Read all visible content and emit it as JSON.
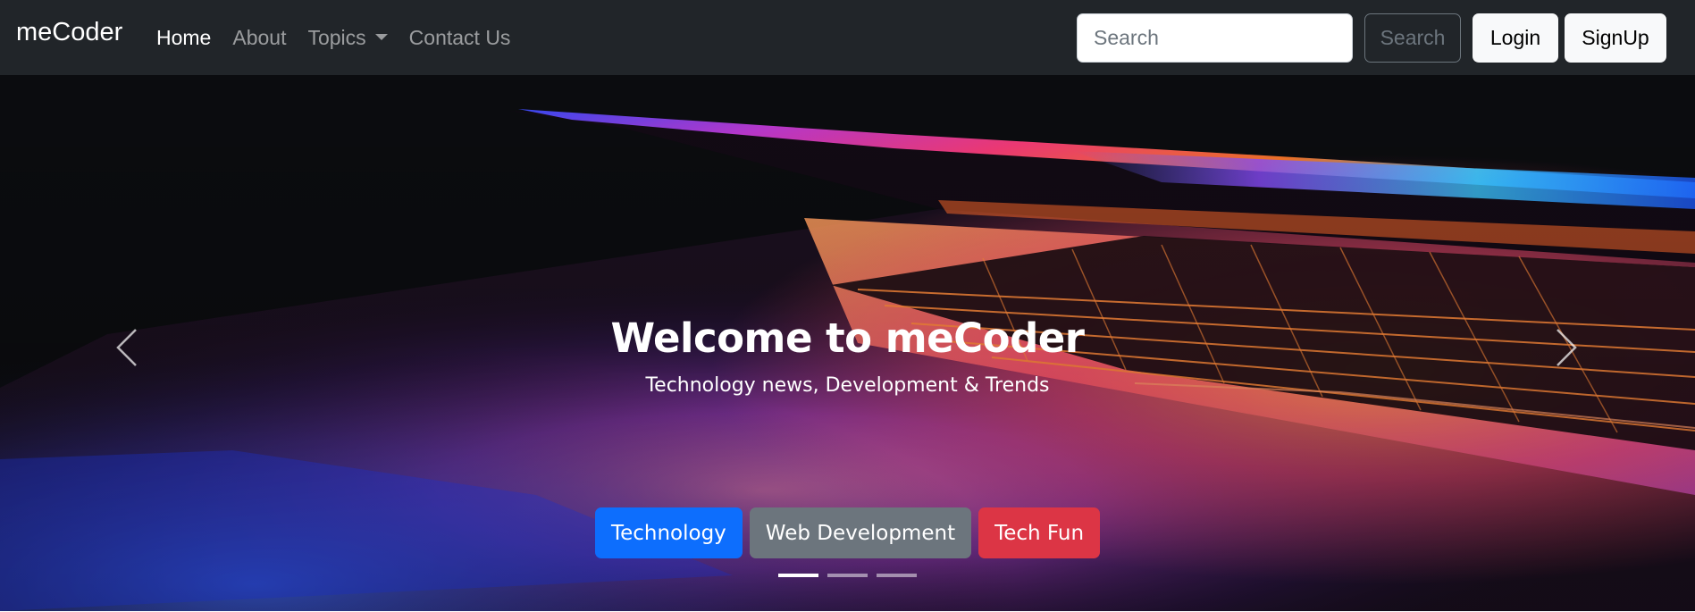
{
  "navbar": {
    "brand": "meCoder",
    "links": [
      {
        "label": "Home",
        "active": true
      },
      {
        "label": "About"
      },
      {
        "label": "Topics",
        "dropdown": true
      },
      {
        "label": "Contact Us"
      }
    ],
    "search": {
      "placeholder": "Search",
      "button_label": "Search"
    },
    "login_label": "Login",
    "signup_label": "SignUp"
  },
  "carousel": {
    "title": "Welcome to meCoder",
    "subtitle": "Technology news, Development & Trends",
    "buttons": [
      {
        "label": "Technology",
        "color": "#0d6efd"
      },
      {
        "label": "Web Development",
        "color": "#6c757d"
      },
      {
        "label": "Tech Fun",
        "color": "#dc3545"
      }
    ],
    "slide_count": 3,
    "active_slide": 1,
    "prev_icon": "chevron-left-icon",
    "next_icon": "chevron-right-icon"
  },
  "colors": {
    "navbar_bg": "#212529",
    "primary": "#0d6efd",
    "secondary": "#6c757d",
    "danger": "#dc3545"
  }
}
